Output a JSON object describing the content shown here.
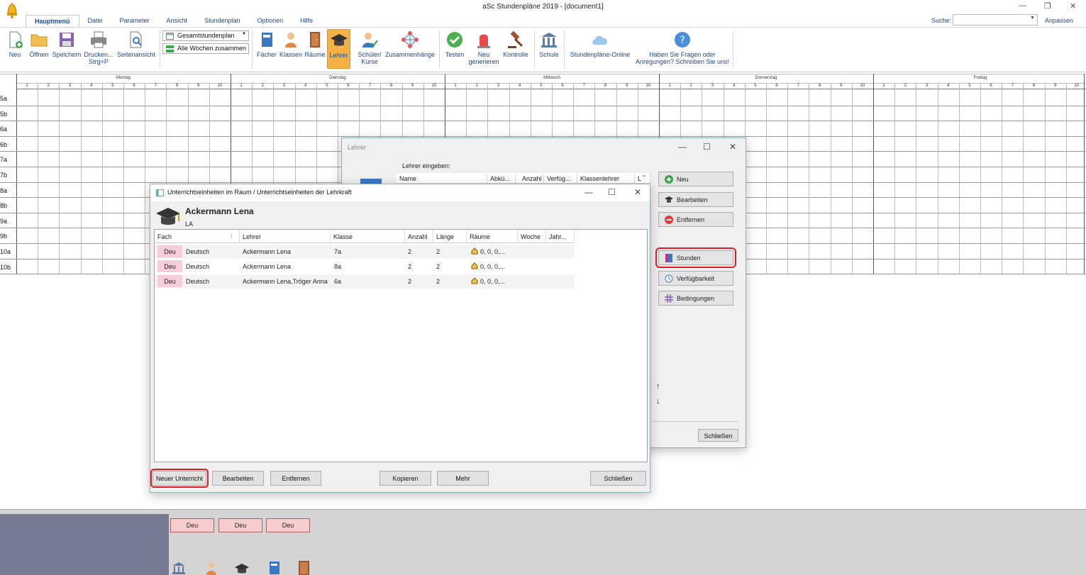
{
  "app": {
    "title": "aSc Stundenpläne 2019  - [document1]",
    "search_label": "Suche:",
    "customize_label": "Anpassen"
  },
  "menu": {
    "tabs": [
      "Hauptmenü",
      "Datei",
      "Parameter",
      "Ansicht",
      "Stundenplan",
      "Optionen",
      "Hilfe"
    ],
    "active_tab": "Hauptmenü"
  },
  "ribbon": {
    "new": "Neu",
    "open": "Öffnen",
    "save": "Speichern",
    "print": "Drucken...",
    "print_sub": "Strg+P",
    "page_view": "Seitenansicht",
    "view_select": "Gesamtstundenplan",
    "weeks_select": "Alle Wochen zusammen",
    "subjects": "Fächer",
    "classes": "Klassen",
    "rooms": "Räume",
    "teachers": "Lehrer",
    "students": "Schüler/",
    "students_sub": "Kurse",
    "relations": "Zusammenhänge",
    "test": "Testen",
    "generate": "Neu",
    "generate_sub": "generieren",
    "control": "Kontrolle",
    "school": "Schule",
    "online": "Stundenpläne-Online",
    "questions": "Haben Sie Fragen oder",
    "questions_sub": "Anregungen? Schreiben Sie uns!"
  },
  "timetable": {
    "days": [
      "Montag",
      "Dienstag",
      "Mittwoch",
      "Donnerstag",
      "Freitag"
    ],
    "periods": [
      "1",
      "2",
      "3",
      "4",
      "5",
      "6",
      "7",
      "8",
      "9",
      "10"
    ],
    "classes": [
      "5a",
      "5b",
      "6a",
      "6b",
      "7a",
      "7b",
      "8a",
      "8b",
      "9a",
      "9b",
      "10a",
      "10b"
    ]
  },
  "teacher_dialog": {
    "title": "Lehrer",
    "prompt": "Lehrer eingeben:",
    "columns": [
      "Name",
      "Abkü...",
      "Anzahl",
      "Verfüg...",
      "Klassenlehrer",
      "L"
    ],
    "buttons": {
      "new": "Neu",
      "edit": "Bearbeiten",
      "remove": "Entfernen",
      "lessons": "Stunden",
      "availability": "Verfügbarkeit",
      "conditions": "Bedingungen",
      "close": "Schließen"
    }
  },
  "lessons_dialog": {
    "title": "Unterrichtseinheiten im Raum / Unterrichtseinheiten der Lehrkraft",
    "teacher_name": "Ackermann Lena",
    "teacher_short": "LA",
    "columns": [
      "Fach",
      "Lehrer",
      "Klasse",
      "Anzahl",
      "Länge",
      "Räume",
      "Woche",
      "Jahr..."
    ],
    "rows": [
      {
        "badge": "Deu",
        "subject": "Deutsch",
        "teacher": "Ackermann Lena",
        "class": "7a",
        "count": "2",
        "length": "2",
        "rooms": "0, 0, 0,..."
      },
      {
        "badge": "Deu",
        "subject": "Deutsch",
        "teacher": "Ackermann Lena",
        "class": "8a",
        "count": "2",
        "length": "2",
        "rooms": "0, 0, 0,..."
      },
      {
        "badge": "Deu",
        "subject": "Deutsch",
        "teacher": "Ackermann Lena,Tröger Anna",
        "class": "6a",
        "count": "2",
        "length": "2",
        "rooms": "0, 0, 0,..."
      }
    ],
    "buttons": {
      "new_lesson": "Neuer Unterricht",
      "edit": "Bearbeiten",
      "remove": "Entfernen",
      "copy": "Kopieren",
      "more": "Mehr",
      "close": "Schließen"
    }
  },
  "bottom_cards": [
    "Deu",
    "Deu",
    "Deu"
  ]
}
